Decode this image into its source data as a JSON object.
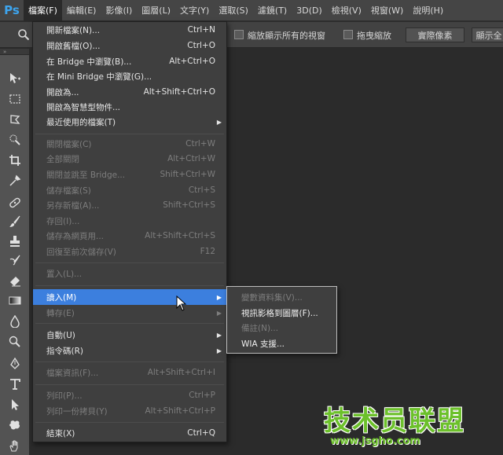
{
  "app": {
    "logo": "Ps"
  },
  "menubar": {
    "items": [
      {
        "label": "檔案(F)",
        "active": true
      },
      {
        "label": "編輯(E)"
      },
      {
        "label": "影像(I)"
      },
      {
        "label": "圖層(L)"
      },
      {
        "label": "文字(Y)"
      },
      {
        "label": "選取(S)"
      },
      {
        "label": "濾鏡(T)"
      },
      {
        "label": "3D(D)"
      },
      {
        "label": "檢視(V)"
      },
      {
        "label": "視窗(W)"
      },
      {
        "label": "說明(H)"
      }
    ]
  },
  "options": {
    "zoom_all_label": "縮放顯示所有的視窗",
    "scrubby_label": "拖曳縮放",
    "actual_pixels": "實際像素",
    "fit_screen": "顯示全"
  },
  "toolbar": {
    "header": "»"
  },
  "file_menu": {
    "items": [
      {
        "label": "開新檔案(N)...",
        "shortcut": "Ctrl+N",
        "enabled": true
      },
      {
        "label": "開啟舊檔(O)...",
        "shortcut": "Ctrl+O",
        "enabled": true
      },
      {
        "label": "在 Bridge 中瀏覽(B)...",
        "shortcut": "Alt+Ctrl+O",
        "enabled": true
      },
      {
        "label": "在 Mini Bridge 中瀏覽(G)...",
        "shortcut": "",
        "enabled": true
      },
      {
        "label": "開啟為...",
        "shortcut": "Alt+Shift+Ctrl+O",
        "enabled": true
      },
      {
        "label": "開啟為智慧型物件...",
        "shortcut": "",
        "enabled": true
      },
      {
        "label": "最近使用的檔案(T)",
        "shortcut": "",
        "enabled": true,
        "submenu": true
      },
      {
        "label": "關閉檔案(C)",
        "shortcut": "Ctrl+W",
        "enabled": false
      },
      {
        "label": "全部關閉",
        "shortcut": "Alt+Ctrl+W",
        "enabled": false
      },
      {
        "label": "關閉並跳至 Bridge...",
        "shortcut": "Shift+Ctrl+W",
        "enabled": false
      },
      {
        "label": "儲存檔案(S)",
        "shortcut": "Ctrl+S",
        "enabled": false
      },
      {
        "label": "另存新檔(A)...",
        "shortcut": "Shift+Ctrl+S",
        "enabled": false
      },
      {
        "label": "存回(I)...",
        "shortcut": "",
        "enabled": false
      },
      {
        "label": "儲存為網頁用...",
        "shortcut": "Alt+Shift+Ctrl+S",
        "enabled": false
      },
      {
        "label": "回復至前次儲存(V)",
        "shortcut": "F12",
        "enabled": false
      },
      {
        "label": "置入(L)...",
        "shortcut": "",
        "enabled": false
      },
      {
        "label": "讀入(M)",
        "shortcut": "",
        "enabled": true,
        "submenu": true,
        "highlighted": true
      },
      {
        "label": "轉存(E)",
        "shortcut": "",
        "enabled": false,
        "submenu": true
      },
      {
        "label": "自動(U)",
        "shortcut": "",
        "enabled": true,
        "submenu": true
      },
      {
        "label": "指令碼(R)",
        "shortcut": "",
        "enabled": true,
        "submenu": true
      },
      {
        "label": "檔案資訊(F)...",
        "shortcut": "Alt+Shift+Ctrl+I",
        "enabled": false
      },
      {
        "label": "列印(P)...",
        "shortcut": "Ctrl+P",
        "enabled": false
      },
      {
        "label": "列印一份拷貝(Y)",
        "shortcut": "Alt+Shift+Ctrl+P",
        "enabled": false
      },
      {
        "label": "結束(X)",
        "shortcut": "Ctrl+Q",
        "enabled": true
      }
    ]
  },
  "import_submenu": {
    "items": [
      {
        "label": "變數資料集(V)...",
        "enabled": false
      },
      {
        "label": "視訊影格到圖層(F)...",
        "enabled": true
      },
      {
        "label": "備註(N)...",
        "enabled": false
      },
      {
        "label": "WIA 支援...",
        "enabled": true
      }
    ]
  },
  "watermark": {
    "title": "技术员联盟",
    "url": "www.jsgho.com"
  }
}
